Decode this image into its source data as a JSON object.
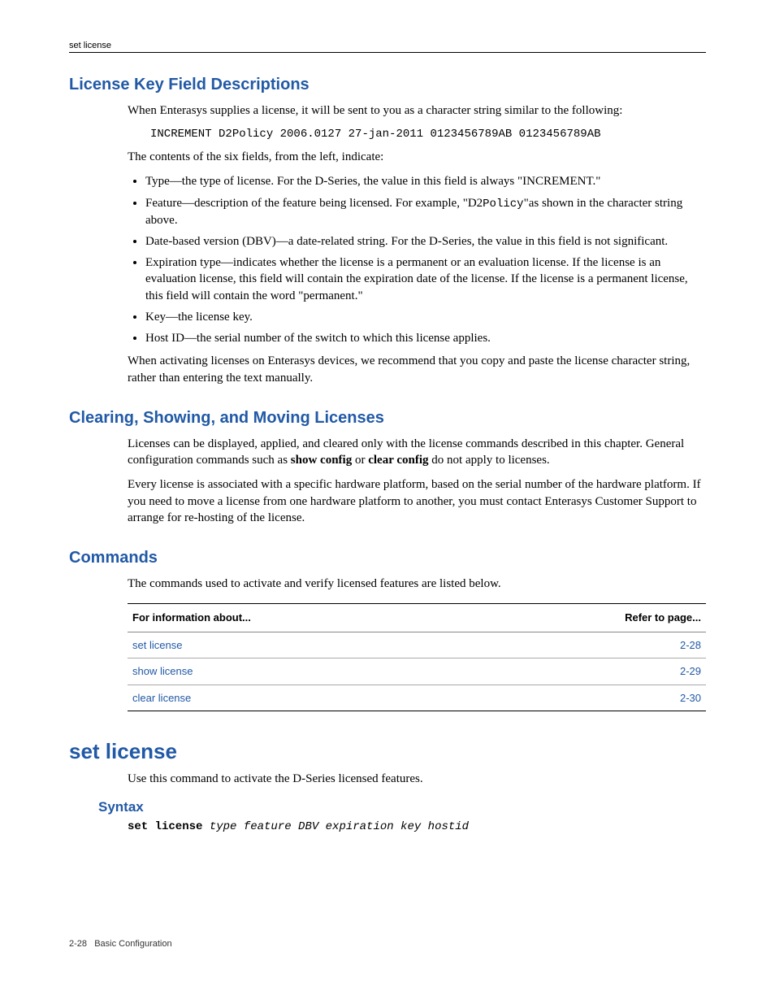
{
  "header": {
    "running": "set license"
  },
  "sec1": {
    "title": "License Key Field Descriptions",
    "intro": "When Enterasys supplies a license, it will be sent to you as a character string similar to the following:",
    "code": "INCREMENT D2Policy 2006.0127 27-jan-2011 0123456789AB 0123456789AB",
    "contents_lead": "The contents of the six fields, from the left, indicate:",
    "bullets": {
      "b1": "Type—the type of license. For the D-Series, the value in this field is always \"INCREMENT.\"",
      "b2a": "Feature—description of the feature being licensed. For example, \"D2",
      "b2code": "Policy",
      "b2b": "\"as shown in the character string above.",
      "b3": "Date-based version (DBV)—a date-related string. For the D-Series, the value in this field is not significant.",
      "b4": "Expiration type—indicates whether the license is a permanent or an evaluation license. If the license is an evaluation license, this field will contain the expiration date of the license. If the license is a permanent license, this field will contain the word \"permanent.\"",
      "b5": "Key—the license key.",
      "b6": "Host ID—the serial number of the switch to which this license applies."
    },
    "outro": "When activating licenses on Enterasys devices, we recommend that you copy and paste the license character string, rather than entering the text manually."
  },
  "sec2": {
    "title": "Clearing, Showing, and Moving Licenses",
    "p1a": "Licenses can be displayed, applied, and cleared only with the license commands described in this chapter. General configuration commands such as ",
    "p1b": "show config",
    "p1c": " or ",
    "p1d": "clear config",
    "p1e": " do not apply to licenses.",
    "p2": "Every license is associated with a specific hardware platform, based on the serial number of the hardware platform. If you need to move a license from one hardware platform to another, you must contact Enterasys Customer Support to arrange for re-hosting of the license."
  },
  "sec3": {
    "title": "Commands",
    "intro": "The commands used to activate and verify licensed features are listed below.",
    "table": {
      "h1": "For information about...",
      "h2": "Refer to page...",
      "rows": [
        {
          "name": "set license",
          "page": "2-28"
        },
        {
          "name": "show license",
          "page": "2-29"
        },
        {
          "name": "clear license",
          "page": "2-30"
        }
      ]
    }
  },
  "sec4": {
    "title": "set license",
    "intro": "Use this command to activate the D-Series licensed features.",
    "syntax_title": "Syntax",
    "syntax_bold": "set license",
    "syntax_italic": " type feature DBV expiration key hostid"
  },
  "footer": {
    "pagenum": "2-28",
    "section": "Basic Configuration"
  }
}
